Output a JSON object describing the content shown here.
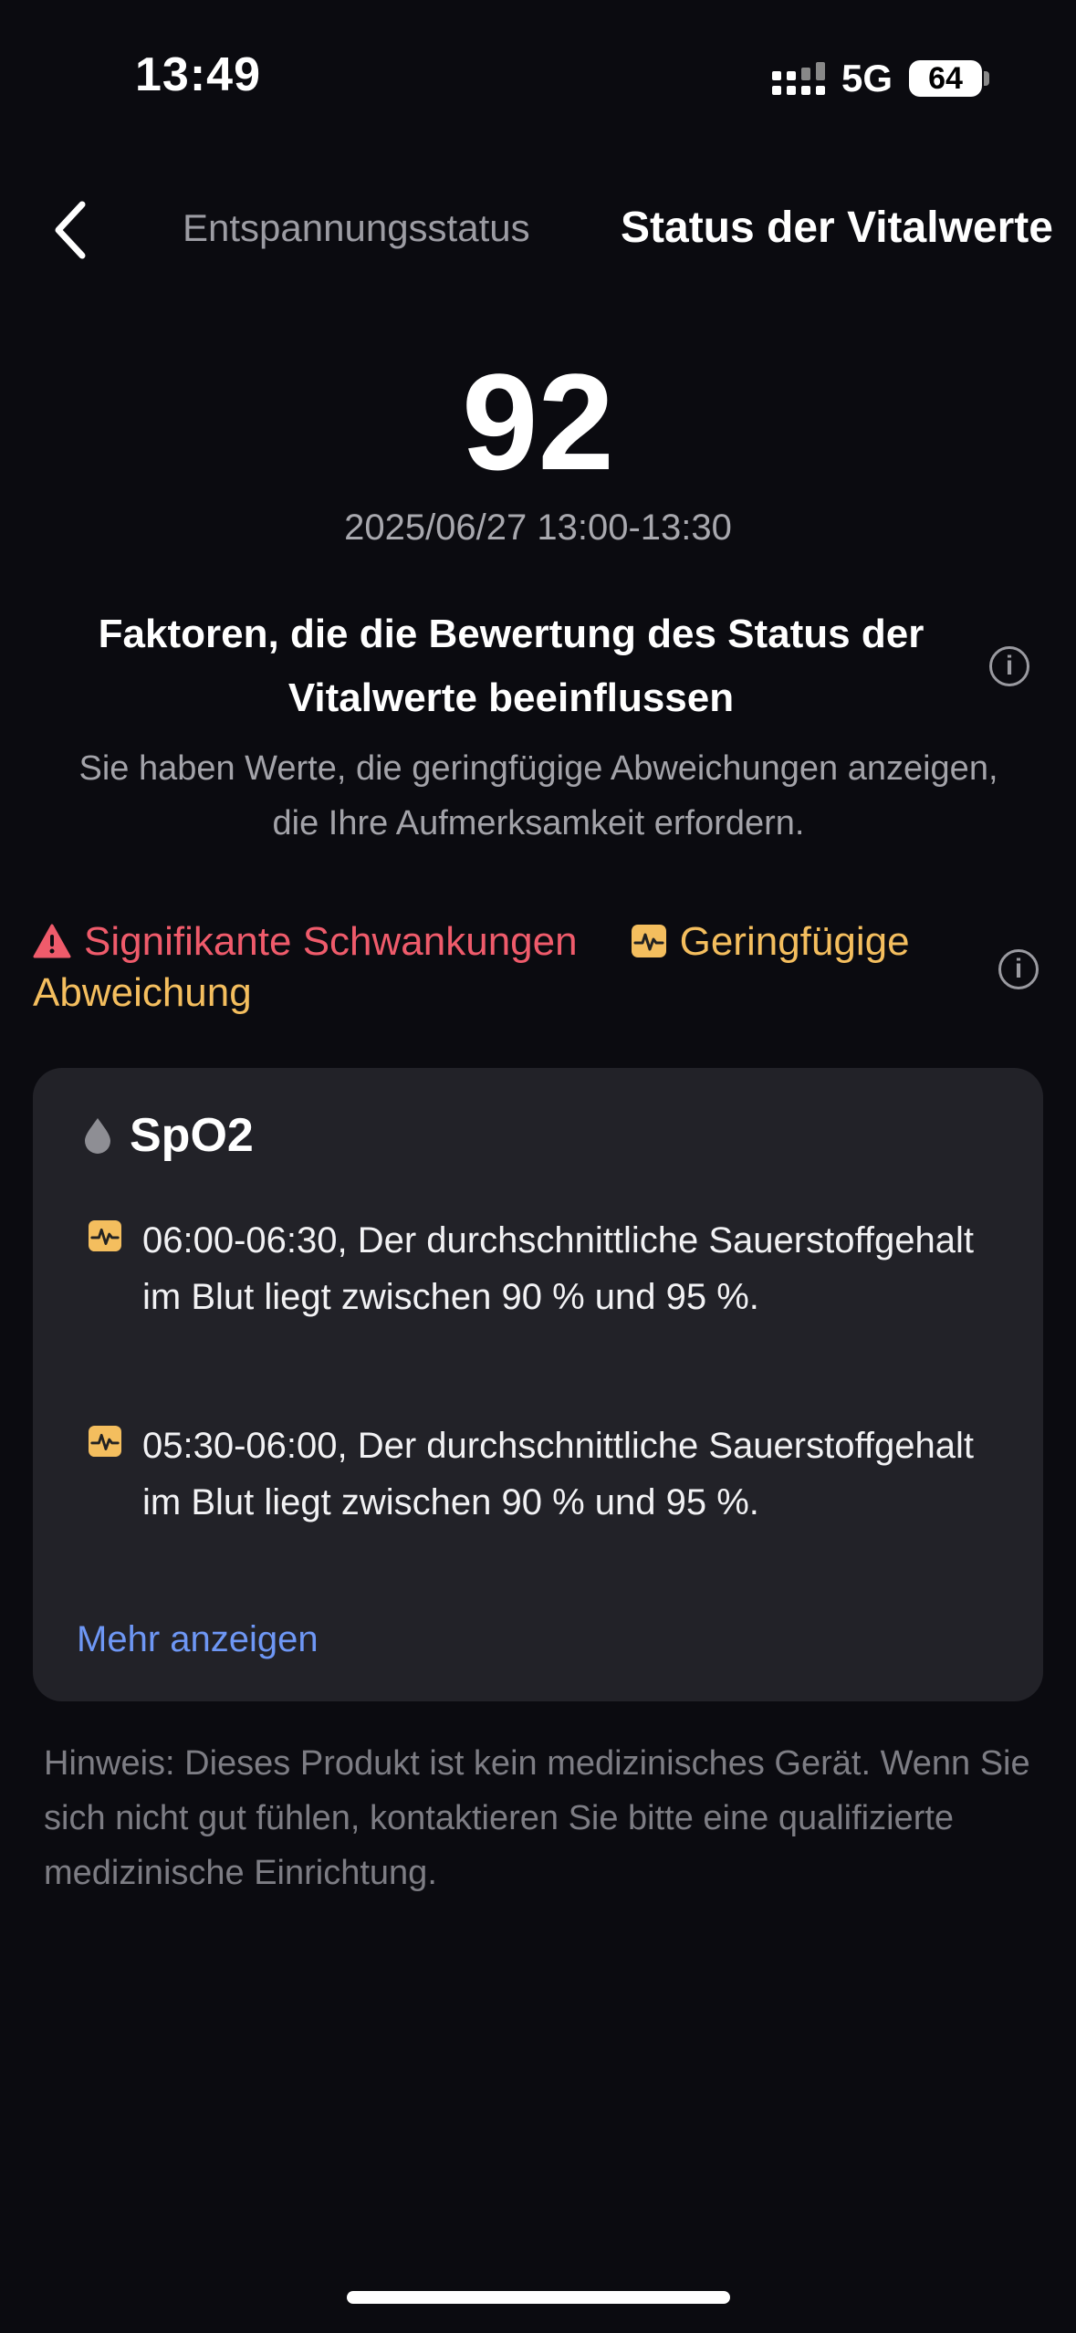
{
  "status_bar": {
    "time": "13:49",
    "network": "5G",
    "battery": "64"
  },
  "header": {
    "tab_inactive": "Entspannungsstatus",
    "tab_active": "Status der Vitalwerte"
  },
  "score": {
    "value": "92",
    "date_range": "2025/06/27 13:00-13:30"
  },
  "factors": {
    "title": "Faktoren, die die Bewertung des Status der Vitalwerte beeinflussen",
    "description": "Sie haben Werte, die geringfügige Abweichungen anzeigen, die Ihre Aufmerksamkeit erfordern."
  },
  "legend": {
    "significant": "Signifikante Schwankungen",
    "minor": "Geringfügige Abweichung"
  },
  "card": {
    "title": "SpO2",
    "entries": [
      {
        "text": "06:00-06:30, Der durchschnittliche Sauerstoffgehalt im Blut liegt zwischen 90 % und 95 %."
      },
      {
        "text": "05:30-06:00, Der durchschnittliche Sauerstoffgehalt im Blut liegt zwischen 90 % und 95 %."
      }
    ],
    "more_label": "Mehr anzeigen"
  },
  "disclaimer": "Hinweis: Dieses Produkt ist kein medizinisches Gerät. Wenn Sie sich nicht gut fühlen, kontaktieren Sie bitte eine qualifizierte medizinische Einrichtung.",
  "colors": {
    "background": "#0b0b10",
    "card": "#222228",
    "significant": "#ef5b6b",
    "minor": "#f4be5e",
    "link": "#6e97f5"
  }
}
